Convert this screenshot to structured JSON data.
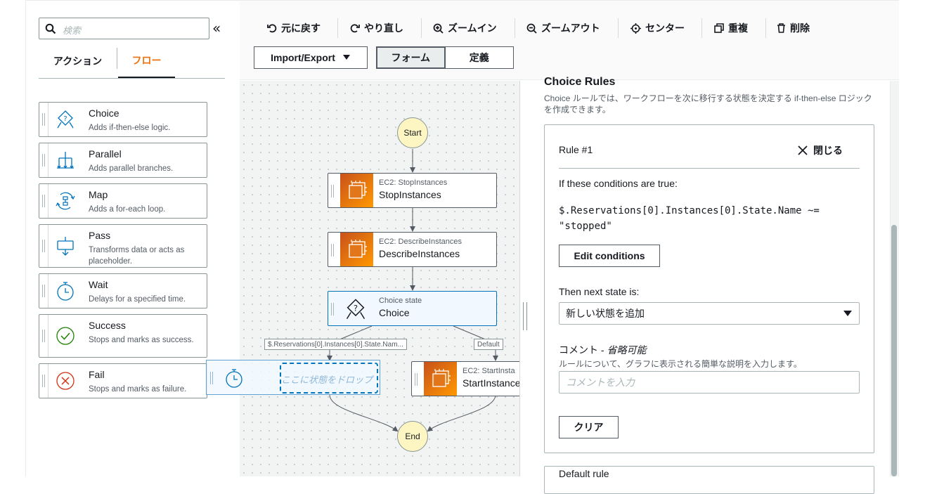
{
  "sidebar": {
    "search_placeholder": "検索",
    "collapse_glyph": "«",
    "tabs": [
      {
        "label": "アクション",
        "active": false
      },
      {
        "label": "フロー",
        "active": true
      }
    ],
    "items": [
      {
        "title": "Choice",
        "desc": "Adds if-then-else logic.",
        "icon": "choice-icon"
      },
      {
        "title": "Parallel",
        "desc": "Adds parallel branches.",
        "icon": "parallel-icon"
      },
      {
        "title": "Map",
        "desc": "Adds a for-each loop.",
        "icon": "map-icon"
      },
      {
        "title": "Pass",
        "desc": "Transforms data or acts as placeholder.",
        "icon": "pass-icon"
      },
      {
        "title": "Wait",
        "desc": "Delays for a specified time.",
        "icon": "wait-icon"
      },
      {
        "title": "Success",
        "desc": "Stops and marks as success.",
        "icon": "success-icon"
      },
      {
        "title": "Fail",
        "desc": "Stops and marks as failure.",
        "icon": "fail-icon"
      }
    ]
  },
  "toolbar": {
    "undo": "元に戻す",
    "redo": "やり直し",
    "zoom_in": "ズームイン",
    "zoom_out": "ズームアウト",
    "center": "センター",
    "duplicate": "重複",
    "delete": "削除",
    "import_export": "Import/Export",
    "view_form": "フォーム",
    "view_definition": "定義",
    "active_view": "フォーム"
  },
  "canvas": {
    "start_label": "Start",
    "end_label": "End",
    "nodes": [
      {
        "sub": "EC2: StopInstances",
        "main": "StopInstances"
      },
      {
        "sub": "EC2: DescribeInstances",
        "main": "DescribeInstances"
      },
      {
        "sub": "Choice state",
        "main": "Choice"
      },
      {
        "sub": "EC2: StartInsta",
        "main": "StartInstance"
      }
    ],
    "edge_label_rule": "$.Reservations[0].Instances[0].State.Nam...",
    "edge_label_default": "Default",
    "drop_zone_text": "ここに状態をドロップ"
  },
  "inspector": {
    "heading": "Choice Rules",
    "description": "Choice ルールでは、ワークフローを次に移行する状態を決定する if-then-else ロジックを作成できます。",
    "rule_title": "Rule #1",
    "close_label": "閉じる",
    "conditions_label": "If these conditions are true:",
    "condition_expr": "$.Reservations[0].Instances[0].State.Name ~= \"stopped\"",
    "edit_conditions": "Edit conditions",
    "next_state_label": "Then next state is:",
    "next_state_value": "新しい状態を追加",
    "comment_label": "コメント - ",
    "comment_optional": "省略可能",
    "comment_desc": "ルールについて、グラフに表示される簡単な説明を入力します。",
    "comment_placeholder": "コメントを入力",
    "clear_label": "クリア",
    "default_rule_title": "Default rule"
  },
  "colors": {
    "accent": "#ec7211",
    "selected_node_bg": "#f1f8ff",
    "selected_node_border": "#0073bb",
    "start_end_fill": "#fdf6c3"
  }
}
